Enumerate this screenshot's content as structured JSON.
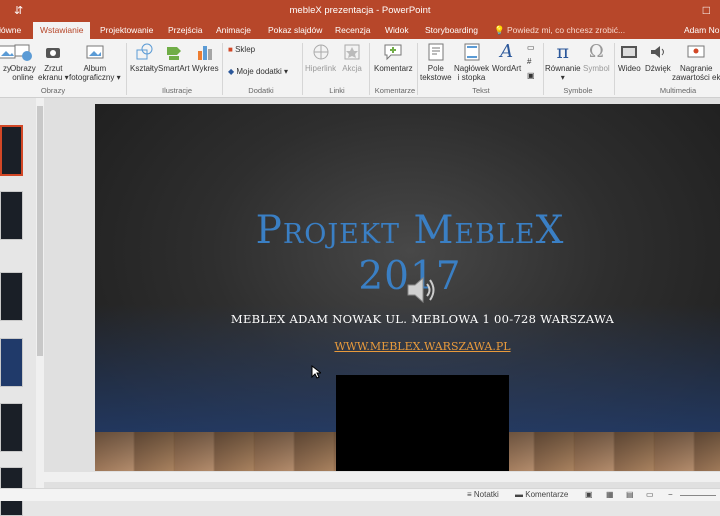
{
  "window": {
    "title": "mebleX prezentacja - PowerPoint",
    "restore_glyph": "□"
  },
  "tabs": [
    {
      "label": "łówne"
    },
    {
      "label": "Wstawianie",
      "active": true
    },
    {
      "label": "Projektowanie"
    },
    {
      "label": "Przejścia"
    },
    {
      "label": "Animacje"
    },
    {
      "label": "Pokaz slajdów"
    },
    {
      "label": "Recenzja"
    },
    {
      "label": "Widok"
    },
    {
      "label": "Storyboarding"
    }
  ],
  "tell_me": {
    "text": "Powiedz mi, co chcesz zrobić...",
    "icon": "lightbulb-icon"
  },
  "user": {
    "name": "Adam No"
  },
  "ribbon": {
    "groups": {
      "obrazy": "Obrazy",
      "ilustracje": "Ilustracje",
      "dodatki": "Dodatki",
      "linki": "Linki",
      "komentarze": "Komentarze",
      "tekst": "Tekst",
      "symbole": "Symbole",
      "multimedia": "Multimedia"
    },
    "buttons": {
      "obrazy_line1": "zy",
      "obrazy_online_1": "Obrazy",
      "obrazy_online_2": "online",
      "zrzut_1": "Zrzut",
      "zrzut_2": "ekranu ▾",
      "album_1": "Album",
      "album_2": "fotograficzny ▾",
      "ksztalty": "Kształty",
      "smartart": "SmartArt",
      "wykres": "Wykres",
      "sklep": "Sklep",
      "moje_dodatki": "Moje dodatki ▾",
      "hiperlink": "Hiperlink",
      "akcja": "Akcja",
      "komentarz": "Komentarz",
      "pole_1": "Pole",
      "pole_2": "tekstowe",
      "naglowek_1": "Nagłówek",
      "naglowek_2": "i stopka",
      "wordart": "WordArt",
      "rownanie": "Równanie",
      "symbol": "Symbol",
      "wideo": "Wideo",
      "dzwiek": "Dźwięk",
      "nagranie_1": "Nagranie",
      "nagranie_2": "zawartości ek"
    },
    "colors": {
      "accent": "#b7472a",
      "ribbon_bg": "#f3f3f3"
    }
  },
  "slide": {
    "title_line1": "Projekt MebleX",
    "title_line2": "2017",
    "subtitle": "MEBLEX ADAM NOWAK UL. MEBLOWA 1 00-728 WARSZAWA",
    "link": "WWW.MEBLEX.WARSZAWA.PL",
    "title_color": "#3a7fc4",
    "link_color": "#e89a3c"
  },
  "statusbar": {
    "notes": "Notatki",
    "comments": "Komentarze"
  }
}
